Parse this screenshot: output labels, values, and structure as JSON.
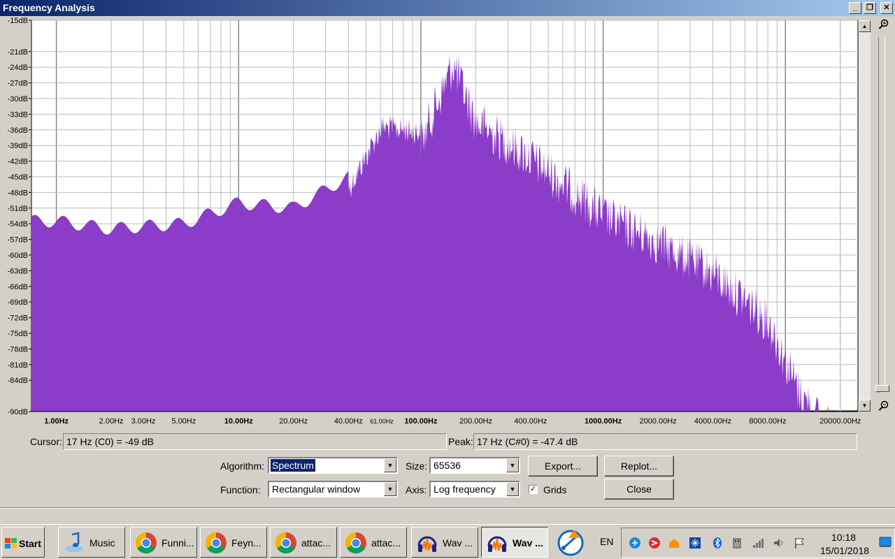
{
  "window": {
    "title": "Frequency Analysis",
    "min": "_",
    "restore": "❐",
    "close": "✕"
  },
  "spectrum": {
    "y_labels": [
      "-15dB",
      "-21dB",
      "-24dB",
      "-27dB",
      "-30dB",
      "-33dB",
      "-36dB",
      "-39dB",
      "-42dB",
      "-45dB",
      "-48dB",
      "-51dB",
      "-54dB",
      "-57dB",
      "-60dB",
      "-63dB",
      "-66dB",
      "-69dB",
      "-72dB",
      "-75dB",
      "-78dB",
      "-81dB",
      "-84dB",
      "-90dB"
    ],
    "x_labels": [
      "1.00Hz",
      "2.00Hz",
      "3.00Hz",
      "5.00Hz",
      "10.00Hz",
      "20.00Hz",
      "40.00Hz",
      "61.00Hz",
      "100.00Hz",
      "200.00Hz",
      "400.00Hz",
      "1000.00Hz",
      "2000.00Hz",
      "4000.00Hz",
      "8000.00Hz",
      "20000.00Hz"
    ],
    "fill_color": "#8b3cc8",
    "grid_color": "#999999"
  },
  "chart_data": {
    "type": "area",
    "x": [
      1,
      2,
      3,
      5,
      10,
      20,
      40,
      61,
      100,
      150,
      200,
      400,
      1000,
      2000,
      4000,
      8000,
      12000,
      16000,
      20000
    ],
    "y": [
      -53.5,
      -55,
      -54.5,
      -54,
      -50,
      -51,
      -45,
      -33,
      -34,
      -19,
      -30,
      -37,
      -48,
      -53,
      -59,
      -68,
      -82,
      -88,
      -90
    ],
    "xlabel": "",
    "ylabel": "",
    "xscale": "log",
    "xlim": [
      0.73,
      25000
    ],
    "ylim": [
      -90,
      -15
    ],
    "grid": true
  },
  "status": {
    "cursor_label": "Cursor:",
    "cursor_value": "17 Hz (C0) = -49 dB",
    "peak_label": "Peak:",
    "peak_value": "17 Hz (C#0) = -47.4 dB"
  },
  "controls": {
    "algorithm_label": "Algorithm:",
    "algorithm_value": "Spectrum",
    "size_label": "Size:",
    "size_value": "65536",
    "export_label": "Export...",
    "replot_label": "Replot...",
    "function_label": "Function:",
    "function_value": "Rectangular window",
    "axis_label": "Axis:",
    "axis_value": "Log frequency",
    "grids_label": "Grids",
    "grids_checked": "✓",
    "close_label": "Close"
  },
  "taskbar": {
    "start_label": "Start",
    "tasks": [
      {
        "label": "Music",
        "icon": "music-icon"
      },
      {
        "label": "Funni...",
        "icon": "chrome-icon"
      },
      {
        "label": "Feyn...",
        "icon": "chrome-icon"
      },
      {
        "label": "attac...",
        "icon": "chrome-icon"
      },
      {
        "label": "attac...",
        "icon": "chrome-icon"
      },
      {
        "label": "Wav ...",
        "icon": "audacity-icon"
      },
      {
        "label": "Wav ...",
        "icon": "audacity-icon"
      }
    ],
    "lang": "EN",
    "time": "10:18",
    "date": "15/01/2018"
  }
}
